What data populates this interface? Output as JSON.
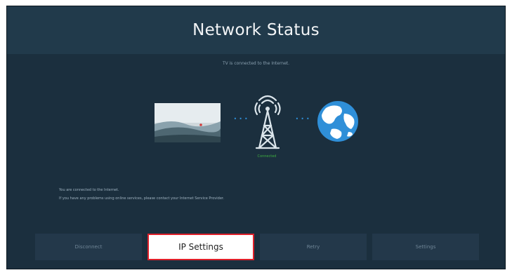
{
  "header": {
    "title": "Network Status"
  },
  "subtitle": "TV is connected to the Internet.",
  "diagram": {
    "tv_icon": "tv-screen-icon",
    "connection_dots": "···",
    "tower_icon": "wifi-tower-icon",
    "tower_label": "Connected",
    "globe_icon": "internet-globe-icon",
    "colors": {
      "dots": "#2f8fd8",
      "tower_label": "#3fae3f",
      "globe": "#2f8fd8"
    }
  },
  "message": {
    "line1": "You are connected to the Internet.",
    "line2": "If you have any problems using online services, please contact your Internet Service Provider."
  },
  "buttons": [
    {
      "label": "Disconnect",
      "focused": false
    },
    {
      "label": "IP Settings",
      "focused": true
    },
    {
      "label": "Retry",
      "focused": false
    },
    {
      "label": "Settings",
      "focused": false
    }
  ],
  "colors": {
    "background": "#1b2f3e",
    "header": "#213a4b",
    "focus_border": "#e0202a"
  }
}
